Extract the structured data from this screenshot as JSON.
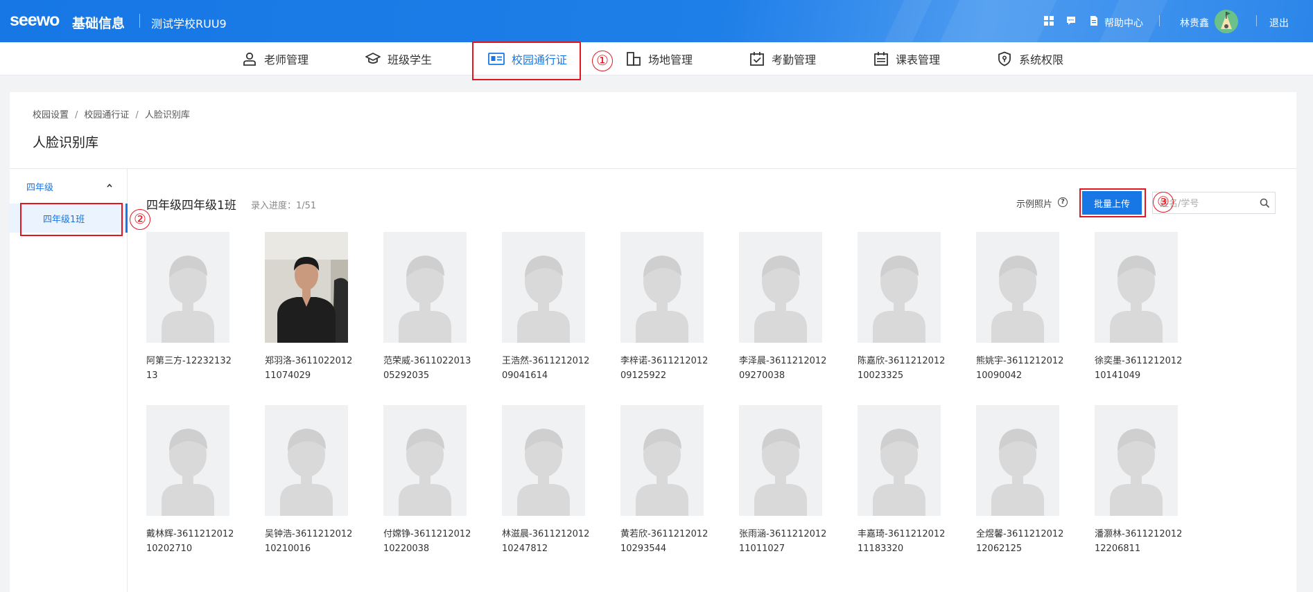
{
  "header": {
    "logo": "seewo",
    "app_name": "基础信息",
    "school": "测试学校RUU9",
    "help_label": "帮助中心",
    "user_name": "林贵鑫",
    "logout_label": "退出"
  },
  "nav": {
    "items": [
      {
        "label": "老师管理",
        "icon": "person-icon"
      },
      {
        "label": "班级学生",
        "icon": "graduation-cap-icon"
      },
      {
        "label": "校园通行证",
        "icon": "id-card-icon"
      },
      {
        "label": "场地管理",
        "icon": "building-icon"
      },
      {
        "label": "考勤管理",
        "icon": "calendar-check-icon"
      },
      {
        "label": "课表管理",
        "icon": "timetable-icon"
      },
      {
        "label": "系统权限",
        "icon": "shield-icon"
      }
    ],
    "active_index": 2
  },
  "annotations": [
    "①",
    "②",
    "③"
  ],
  "breadcrumb": [
    "校园设置",
    "校园通行证",
    "人脸识别库"
  ],
  "breadcrumb_sep": "/",
  "page_title": "人脸识别库",
  "sidebar": {
    "grade": "四年级",
    "class": "四年级1班"
  },
  "content": {
    "class_title": "四年级四年级1班",
    "progress_label": "录入进度：1/51",
    "sample_label": "示例照片",
    "help_glyph": "?",
    "upload_label": "批量上传",
    "search_placeholder": "姓名/学号",
    "search_value": ""
  },
  "students": [
    {
      "name": "阿第三方-1223213213",
      "has_photo": false
    },
    {
      "name": "郑羽洛-361102201211074029",
      "has_photo": true
    },
    {
      "name": "范荣威-361102201305292035",
      "has_photo": false
    },
    {
      "name": "王浩然-361121201209041614",
      "has_photo": false
    },
    {
      "name": "李梓诺-361121201209125922",
      "has_photo": false
    },
    {
      "name": "李泽晨-361121201209270038",
      "has_photo": false
    },
    {
      "name": "陈嘉欣-361121201210023325",
      "has_photo": false
    },
    {
      "name": "熊姚宇-361121201210090042",
      "has_photo": false
    },
    {
      "name": "徐奕墨-361121201210141049",
      "has_photo": false
    },
    {
      "name": "戴林辉-361121201210202710",
      "has_photo": false
    },
    {
      "name": "吴钟浩-361121201210210016",
      "has_photo": false
    },
    {
      "name": "付嫦铮-361121201210220038",
      "has_photo": false
    },
    {
      "name": "林滋晨-361121201210247812",
      "has_photo": false
    },
    {
      "name": "黄若欣-361121201210293544",
      "has_photo": false
    },
    {
      "name": "张雨涵-361121201211011027",
      "has_photo": false
    },
    {
      "name": "丰嘉琦-361121201211183320",
      "has_photo": false
    },
    {
      "name": "全煜馨-361121201212062125",
      "has_photo": false
    },
    {
      "name": "潘灏林-361121201212206811",
      "has_photo": false
    }
  ],
  "colors": {
    "primary": "#1677e5",
    "annotation_red": "#e6141e"
  }
}
